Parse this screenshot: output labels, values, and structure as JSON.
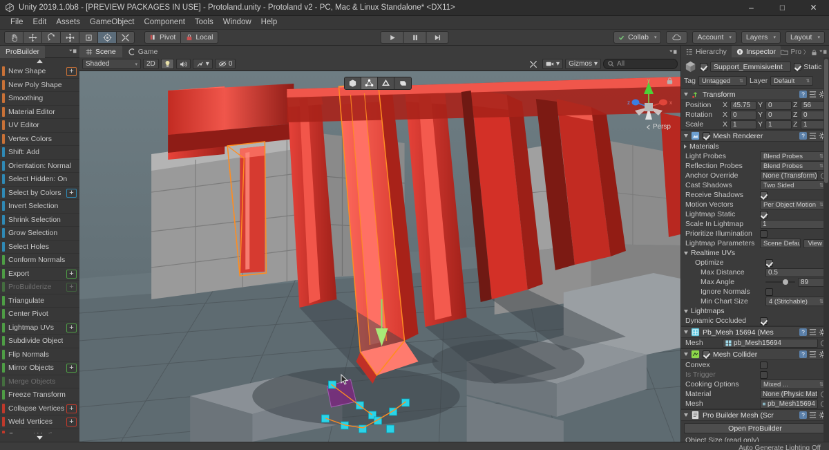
{
  "window": {
    "title": "Unity 2019.1.0b8 - [PREVIEW PACKAGES IN USE] - Protoland.unity - Protoland v2 - PC, Mac & Linux Standalone* <DX11>",
    "minimize": "–",
    "maximize": "□",
    "close": "✕"
  },
  "menubar": {
    "items": [
      "File",
      "Edit",
      "Assets",
      "GameObject",
      "Component",
      "Tools",
      "Window",
      "Help"
    ]
  },
  "toolbar": {
    "transform_tools": [
      "hand-tool",
      "move-tool",
      "rotate-tool",
      "scale-tool",
      "rect-tool",
      "transform-tool",
      "custom-tool"
    ],
    "pivot_label": "Pivot",
    "local_label": "Local",
    "play_label": "▶",
    "pause_label": "❙❙",
    "step_label": "▶❘",
    "collab_label": "Collab",
    "cloud_label": "",
    "account_label": "Account",
    "layers_label": "Layers",
    "layout_label": "Layout",
    "caret": "▾"
  },
  "probuilder": {
    "tab_label": "ProBuilder",
    "scroll_up": "▲",
    "scroll_down": "▼",
    "plus": "+",
    "items": [
      {
        "label": "New Shape",
        "color": "#c87137",
        "plus": true,
        "disabled": false
      },
      {
        "label": "New Poly Shape",
        "color": "#c87137",
        "plus": false,
        "disabled": false
      },
      {
        "label": "Smoothing",
        "color": "#c87137",
        "plus": false,
        "disabled": false
      },
      {
        "label": "Material Editor",
        "color": "#c87137",
        "plus": false,
        "disabled": false
      },
      {
        "label": "UV Editor",
        "color": "#c87137",
        "plus": false,
        "disabled": false
      },
      {
        "label": "Vertex Colors",
        "color": "#c87137",
        "plus": false,
        "disabled": false
      },
      {
        "label": "Shift: Add",
        "color": "#2f89b5",
        "plus": false,
        "disabled": false
      },
      {
        "label": "Orientation: Normal",
        "color": "#2f89b5",
        "plus": false,
        "disabled": false
      },
      {
        "label": "Select Hidden: On",
        "color": "#2f89b5",
        "plus": false,
        "disabled": false
      },
      {
        "label": "Select by Colors",
        "color": "#2f89b5",
        "plus": true,
        "disabled": false
      },
      {
        "label": "Invert Selection",
        "color": "#2f89b5",
        "plus": false,
        "disabled": false
      },
      {
        "label": "Shrink Selection",
        "color": "#2f89b5",
        "plus": false,
        "disabled": false
      },
      {
        "label": "Grow Selection",
        "color": "#2f89b5",
        "plus": false,
        "disabled": false
      },
      {
        "label": "Select Holes",
        "color": "#2f89b5",
        "plus": false,
        "disabled": false
      },
      {
        "label": "Conform Normals",
        "color": "#4e9d45",
        "plus": false,
        "disabled": false
      },
      {
        "label": "Export",
        "color": "#4e9d45",
        "plus": true,
        "disabled": false
      },
      {
        "label": "ProBuilderize",
        "color": "#4e9d45",
        "plus": true,
        "disabled": true
      },
      {
        "label": "Triangulate",
        "color": "#4e9d45",
        "plus": false,
        "disabled": false
      },
      {
        "label": "Center Pivot",
        "color": "#4e9d45",
        "plus": false,
        "disabled": false
      },
      {
        "label": "Lightmap UVs",
        "color": "#4e9d45",
        "plus": true,
        "disabled": false
      },
      {
        "label": "Subdivide Object",
        "color": "#4e9d45",
        "plus": false,
        "disabled": false
      },
      {
        "label": "Flip Normals",
        "color": "#4e9d45",
        "plus": false,
        "disabled": false
      },
      {
        "label": "Mirror Objects",
        "color": "#4e9d45",
        "plus": true,
        "disabled": false
      },
      {
        "label": "Merge Objects",
        "color": "#4e9d45",
        "plus": false,
        "disabled": true
      },
      {
        "label": "Freeze Transform",
        "color": "#4e9d45",
        "plus": false,
        "disabled": false
      },
      {
        "label": "Collapse Vertices",
        "color": "#c0392b",
        "plus": true,
        "disabled": false
      },
      {
        "label": "Weld Vertices",
        "color": "#c0392b",
        "plus": true,
        "disabled": false
      },
      {
        "label": "Connect Vertices",
        "color": "#c0392b",
        "plus": false,
        "disabled": false
      }
    ]
  },
  "scene": {
    "tabs": [
      {
        "label": "Scene",
        "icon": "scene-grid-icon",
        "active": true
      },
      {
        "label": "Game",
        "icon": "game-icon",
        "active": false
      }
    ],
    "draw_mode": "Shaded",
    "two_d": "2D",
    "lighting_icon": "lightbulb-icon",
    "audio_icon": "speaker-icon",
    "fx_label": "",
    "hidden_count": "0",
    "gizmos_label": "Gizmos",
    "search_placeholder": "All",
    "caret": "▾",
    "persp_label": "Persp",
    "axis_x": "x",
    "axis_y": "y",
    "axis_z": "z",
    "element_modes": [
      "object-mode",
      "vertex-mode",
      "edge-mode",
      "face-mode"
    ]
  },
  "inspector": {
    "tabs": [
      {
        "label": "Hierarchy",
        "active": false
      },
      {
        "label": "Inspector",
        "active": true
      }
    ],
    "lock_label": "Pro",
    "object": {
      "name": "Support_EmmisiveInt",
      "static_label": "Static",
      "tag_label": "Tag",
      "tag_value": "Untagged",
      "layer_label": "Layer",
      "layer_value": "Default",
      "enabled": true,
      "static_checked": true
    },
    "transform": {
      "title": "Transform",
      "rows": [
        {
          "label": "Position",
          "x": "45.75",
          "y": "0",
          "z": "56"
        },
        {
          "label": "Rotation",
          "x": "0",
          "y": "0",
          "z": "0"
        },
        {
          "label": "Scale",
          "x": "1",
          "y": "1",
          "z": "1"
        }
      ]
    },
    "mesh_renderer": {
      "title": "Mesh Renderer",
      "enabled": true,
      "materials_label": "Materials",
      "props": [
        {
          "label": "Light Probes",
          "value": "Blend Probes",
          "type": "dropdown"
        },
        {
          "label": "Reflection Probes",
          "value": "Blend Probes",
          "type": "dropdown"
        },
        {
          "label": "Anchor Override",
          "value": "None (Transform)",
          "type": "object"
        },
        {
          "label": "Cast Shadows",
          "value": "Two Sided",
          "type": "dropdown"
        },
        {
          "label": "Receive Shadows",
          "value": "",
          "type": "checkbox",
          "checked": true
        },
        {
          "label": "Motion Vectors",
          "value": "Per Object Motion",
          "type": "dropdown"
        },
        {
          "label": "Lightmap Static",
          "value": "",
          "type": "checkbox",
          "checked": true
        },
        {
          "label": "Scale In Lightmap",
          "value": "1",
          "type": "field"
        },
        {
          "label": "Prioritize Illumination",
          "value": "",
          "type": "checkbox",
          "checked": false
        },
        {
          "label": "Lightmap Parameters",
          "value": "Scene Default",
          "type": "dropdown-view",
          "button": "View"
        }
      ],
      "realtime_uvs": {
        "title": "Realtime UVs",
        "props": [
          {
            "label": "Optimize",
            "value": "",
            "type": "checkbox",
            "checked": true,
            "indent": 1
          },
          {
            "label": "Max Distance",
            "value": "0.5",
            "type": "field",
            "indent": 2
          },
          {
            "label": "Max Angle",
            "value": "89",
            "type": "slider",
            "indent": 2,
            "slider_pct": 58
          },
          {
            "label": "Ignore Normals",
            "value": "",
            "type": "checkbox",
            "checked": false,
            "indent": 2
          },
          {
            "label": "Min Chart Size",
            "value": "4 (Stitchable)",
            "type": "dropdown",
            "indent": 2
          }
        ]
      },
      "lightmaps": {
        "title": "Lightmaps",
        "props": [
          {
            "label": "Dynamic Occluded",
            "value": "",
            "type": "checkbox",
            "checked": true,
            "indent": 0
          }
        ]
      }
    },
    "mesh_filter": {
      "title": "Pb_Mesh 15694 (Mes",
      "mesh_label": "Mesh",
      "mesh_value": "pb_Mesh15694"
    },
    "mesh_collider": {
      "title": "Mesh Collider",
      "enabled": true,
      "props": [
        {
          "label": "Convex",
          "value": "",
          "type": "checkbox",
          "checked": false
        },
        {
          "label": "Is Trigger",
          "value": "",
          "type": "checkbox",
          "checked": false,
          "dim": true
        },
        {
          "label": "Cooking Options",
          "value": "Mixed ...",
          "type": "dropdown"
        },
        {
          "label": "Material",
          "value": "None (Physic Mate",
          "type": "object"
        },
        {
          "label": "Mesh",
          "value": "pb_Mesh15694",
          "type": "mesh"
        }
      ]
    },
    "probuilder_mesh": {
      "title": "Pro Builder Mesh (Scr",
      "open_button": "Open ProBuilder",
      "object_size_label": "Object Size (read only)"
    }
  },
  "statusbar": {
    "text": "Auto Generate Lighting Off"
  },
  "colors": {
    "accent_orange": "#c87137",
    "accent_blue": "#2f89b5",
    "accent_green": "#4e9d45",
    "accent_red": "#c0392b",
    "selection_cyan": "#2ad4e8",
    "selection_orange": "#ff8c21",
    "mesh_red": "#e8423a"
  }
}
